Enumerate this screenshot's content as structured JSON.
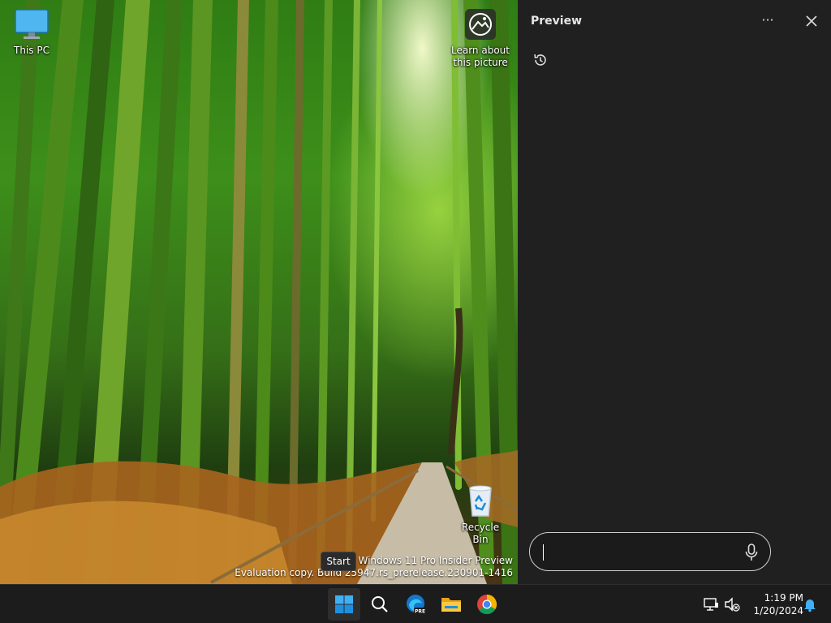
{
  "desktop": {
    "icons": {
      "this_pc": "This PC",
      "learn_line1": "Learn about",
      "learn_line2": "this picture",
      "recycle_bin": "Recycle Bin"
    },
    "watermark": {
      "line1": "Windows 11 Pro Insider Preview",
      "line2": "Evaluation copy. Build 25947.rs_prerelease.230901-1416"
    },
    "tooltip": "Start"
  },
  "pane": {
    "title": "Preview",
    "more_label": "···",
    "input_value": "",
    "input_placeholder": ""
  },
  "taskbar": {
    "time": "1:19 PM",
    "date": "1/20/2024",
    "apps": [
      "start-icon",
      "search-icon",
      "edge-preview-icon",
      "file-explorer-icon",
      "chrome-icon"
    ],
    "accent": "#0078d4"
  }
}
